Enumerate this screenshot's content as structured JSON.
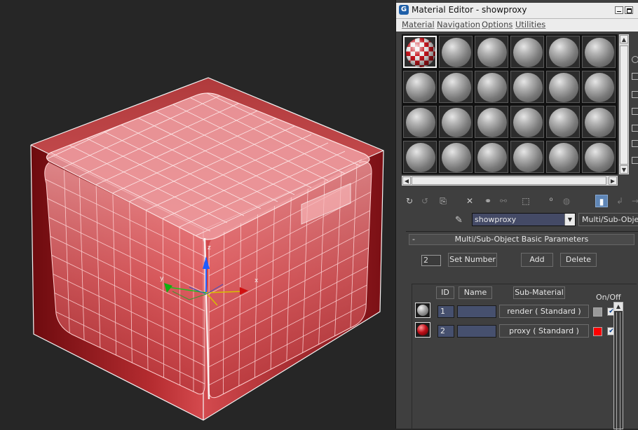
{
  "window": {
    "title": "Material Editor - showproxy"
  },
  "menu": [
    "Material",
    "Navigation",
    "Options",
    "Utilities"
  ],
  "viewport": {
    "axes": {
      "x": "x",
      "y": "y",
      "z": "z"
    }
  },
  "slots": {
    "rows": 4,
    "cols": 6,
    "active": 0
  },
  "material": {
    "name": "showproxy",
    "type": "Multi/Sub-Object"
  },
  "rollout": {
    "title": "Multi/Sub-Object Basic Parameters",
    "collapse_glyph": "-",
    "count": "2",
    "set_number": "Set Number",
    "add": "Add",
    "delete": "Delete",
    "headers": {
      "id": "ID",
      "name": "Name",
      "submaterial": "Sub-Material",
      "onoff": "On/Off"
    },
    "rows": [
      {
        "id": "1",
        "name": "",
        "submaterial": "render  ( Standard )",
        "color": "#999999",
        "on": true
      },
      {
        "id": "2",
        "name": "",
        "submaterial": "proxy  ( Standard )",
        "color": "#ff0000",
        "on": true
      }
    ]
  }
}
